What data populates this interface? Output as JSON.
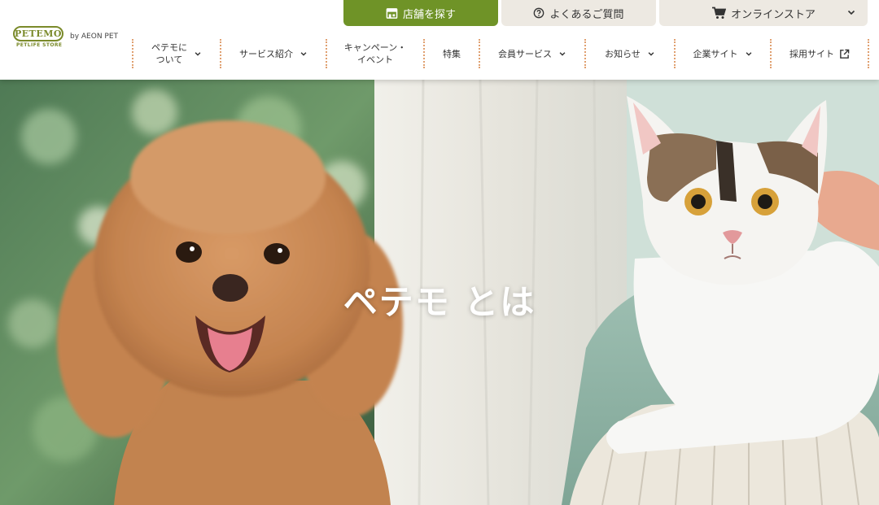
{
  "brand": {
    "logo_text": "PETEMO",
    "logo_sub": "PETLIFE STORE",
    "by_label": "by AEON PET"
  },
  "utility": {
    "store_label": "店舗を探す",
    "faq_label": "よくあるご質問",
    "shop_label": "オンラインストア"
  },
  "nav": {
    "about": "ペテモに\nついて",
    "services": "サービス紹介",
    "campaign": "キャンペーン・\nイベント",
    "features": "特集",
    "member": "会員サービス",
    "news": "お知らせ",
    "corporate": "企業サイト",
    "recruit": "採用サイト"
  },
  "hero": {
    "title": "ペテモ とは"
  },
  "colors": {
    "accent_green": "#6f9327",
    "utility_beige": "#ede9e2",
    "divider_orange": "#e0a070"
  },
  "icons": {
    "store": "storefront-icon",
    "faq": "question-circle-icon",
    "shop": "cart-icon",
    "dropdown": "chevron-down-icon",
    "external": "external-link-icon"
  }
}
